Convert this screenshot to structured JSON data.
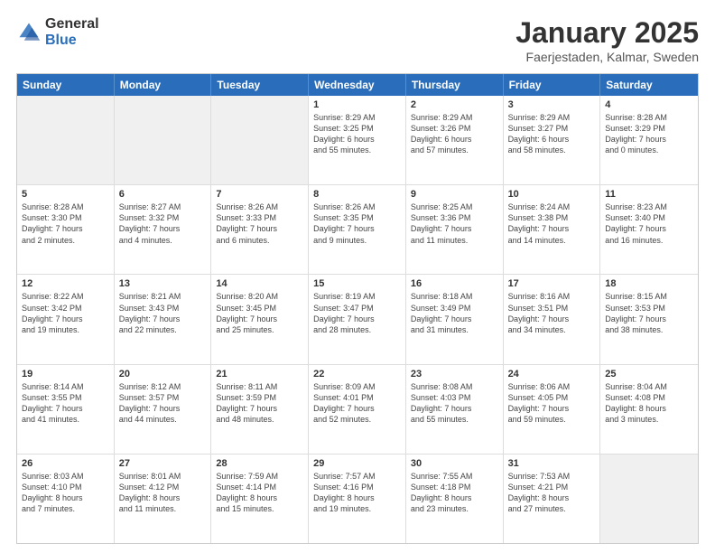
{
  "logo": {
    "general": "General",
    "blue": "Blue"
  },
  "title": "January 2025",
  "subtitle": "Faerjestaden, Kalmar, Sweden",
  "dayHeaders": [
    "Sunday",
    "Monday",
    "Tuesday",
    "Wednesday",
    "Thursday",
    "Friday",
    "Saturday"
  ],
  "rows": [
    [
      {
        "day": "",
        "lines": [],
        "empty": true
      },
      {
        "day": "",
        "lines": [],
        "empty": true
      },
      {
        "day": "",
        "lines": [],
        "empty": true
      },
      {
        "day": "1",
        "lines": [
          "Sunrise: 8:29 AM",
          "Sunset: 3:25 PM",
          "Daylight: 6 hours",
          "and 55 minutes."
        ],
        "empty": false
      },
      {
        "day": "2",
        "lines": [
          "Sunrise: 8:29 AM",
          "Sunset: 3:26 PM",
          "Daylight: 6 hours",
          "and 57 minutes."
        ],
        "empty": false
      },
      {
        "day": "3",
        "lines": [
          "Sunrise: 8:29 AM",
          "Sunset: 3:27 PM",
          "Daylight: 6 hours",
          "and 58 minutes."
        ],
        "empty": false
      },
      {
        "day": "4",
        "lines": [
          "Sunrise: 8:28 AM",
          "Sunset: 3:29 PM",
          "Daylight: 7 hours",
          "and 0 minutes."
        ],
        "empty": false
      }
    ],
    [
      {
        "day": "5",
        "lines": [
          "Sunrise: 8:28 AM",
          "Sunset: 3:30 PM",
          "Daylight: 7 hours",
          "and 2 minutes."
        ],
        "empty": false
      },
      {
        "day": "6",
        "lines": [
          "Sunrise: 8:27 AM",
          "Sunset: 3:32 PM",
          "Daylight: 7 hours",
          "and 4 minutes."
        ],
        "empty": false
      },
      {
        "day": "7",
        "lines": [
          "Sunrise: 8:26 AM",
          "Sunset: 3:33 PM",
          "Daylight: 7 hours",
          "and 6 minutes."
        ],
        "empty": false
      },
      {
        "day": "8",
        "lines": [
          "Sunrise: 8:26 AM",
          "Sunset: 3:35 PM",
          "Daylight: 7 hours",
          "and 9 minutes."
        ],
        "empty": false
      },
      {
        "day": "9",
        "lines": [
          "Sunrise: 8:25 AM",
          "Sunset: 3:36 PM",
          "Daylight: 7 hours",
          "and 11 minutes."
        ],
        "empty": false
      },
      {
        "day": "10",
        "lines": [
          "Sunrise: 8:24 AM",
          "Sunset: 3:38 PM",
          "Daylight: 7 hours",
          "and 14 minutes."
        ],
        "empty": false
      },
      {
        "day": "11",
        "lines": [
          "Sunrise: 8:23 AM",
          "Sunset: 3:40 PM",
          "Daylight: 7 hours",
          "and 16 minutes."
        ],
        "empty": false
      }
    ],
    [
      {
        "day": "12",
        "lines": [
          "Sunrise: 8:22 AM",
          "Sunset: 3:42 PM",
          "Daylight: 7 hours",
          "and 19 minutes."
        ],
        "empty": false
      },
      {
        "day": "13",
        "lines": [
          "Sunrise: 8:21 AM",
          "Sunset: 3:43 PM",
          "Daylight: 7 hours",
          "and 22 minutes."
        ],
        "empty": false
      },
      {
        "day": "14",
        "lines": [
          "Sunrise: 8:20 AM",
          "Sunset: 3:45 PM",
          "Daylight: 7 hours",
          "and 25 minutes."
        ],
        "empty": false
      },
      {
        "day": "15",
        "lines": [
          "Sunrise: 8:19 AM",
          "Sunset: 3:47 PM",
          "Daylight: 7 hours",
          "and 28 minutes."
        ],
        "empty": false
      },
      {
        "day": "16",
        "lines": [
          "Sunrise: 8:18 AM",
          "Sunset: 3:49 PM",
          "Daylight: 7 hours",
          "and 31 minutes."
        ],
        "empty": false
      },
      {
        "day": "17",
        "lines": [
          "Sunrise: 8:16 AM",
          "Sunset: 3:51 PM",
          "Daylight: 7 hours",
          "and 34 minutes."
        ],
        "empty": false
      },
      {
        "day": "18",
        "lines": [
          "Sunrise: 8:15 AM",
          "Sunset: 3:53 PM",
          "Daylight: 7 hours",
          "and 38 minutes."
        ],
        "empty": false
      }
    ],
    [
      {
        "day": "19",
        "lines": [
          "Sunrise: 8:14 AM",
          "Sunset: 3:55 PM",
          "Daylight: 7 hours",
          "and 41 minutes."
        ],
        "empty": false
      },
      {
        "day": "20",
        "lines": [
          "Sunrise: 8:12 AM",
          "Sunset: 3:57 PM",
          "Daylight: 7 hours",
          "and 44 minutes."
        ],
        "empty": false
      },
      {
        "day": "21",
        "lines": [
          "Sunrise: 8:11 AM",
          "Sunset: 3:59 PM",
          "Daylight: 7 hours",
          "and 48 minutes."
        ],
        "empty": false
      },
      {
        "day": "22",
        "lines": [
          "Sunrise: 8:09 AM",
          "Sunset: 4:01 PM",
          "Daylight: 7 hours",
          "and 52 minutes."
        ],
        "empty": false
      },
      {
        "day": "23",
        "lines": [
          "Sunrise: 8:08 AM",
          "Sunset: 4:03 PM",
          "Daylight: 7 hours",
          "and 55 minutes."
        ],
        "empty": false
      },
      {
        "day": "24",
        "lines": [
          "Sunrise: 8:06 AM",
          "Sunset: 4:05 PM",
          "Daylight: 7 hours",
          "and 59 minutes."
        ],
        "empty": false
      },
      {
        "day": "25",
        "lines": [
          "Sunrise: 8:04 AM",
          "Sunset: 4:08 PM",
          "Daylight: 8 hours",
          "and 3 minutes."
        ],
        "empty": false
      }
    ],
    [
      {
        "day": "26",
        "lines": [
          "Sunrise: 8:03 AM",
          "Sunset: 4:10 PM",
          "Daylight: 8 hours",
          "and 7 minutes."
        ],
        "empty": false
      },
      {
        "day": "27",
        "lines": [
          "Sunrise: 8:01 AM",
          "Sunset: 4:12 PM",
          "Daylight: 8 hours",
          "and 11 minutes."
        ],
        "empty": false
      },
      {
        "day": "28",
        "lines": [
          "Sunrise: 7:59 AM",
          "Sunset: 4:14 PM",
          "Daylight: 8 hours",
          "and 15 minutes."
        ],
        "empty": false
      },
      {
        "day": "29",
        "lines": [
          "Sunrise: 7:57 AM",
          "Sunset: 4:16 PM",
          "Daylight: 8 hours",
          "and 19 minutes."
        ],
        "empty": false
      },
      {
        "day": "30",
        "lines": [
          "Sunrise: 7:55 AM",
          "Sunset: 4:18 PM",
          "Daylight: 8 hours",
          "and 23 minutes."
        ],
        "empty": false
      },
      {
        "day": "31",
        "lines": [
          "Sunrise: 7:53 AM",
          "Sunset: 4:21 PM",
          "Daylight: 8 hours",
          "and 27 minutes."
        ],
        "empty": false
      },
      {
        "day": "",
        "lines": [],
        "empty": true
      }
    ]
  ]
}
